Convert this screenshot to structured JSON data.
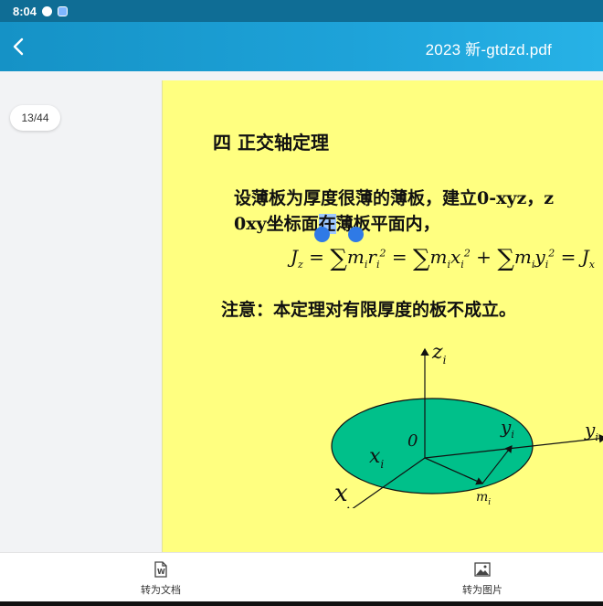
{
  "status_bar": {
    "time": "8:04",
    "icons": [
      "qq-icon",
      "app-notification-icon"
    ]
  },
  "app_bar": {
    "back_icon": "chevron-left-icon",
    "title": "2023 新-gtdzd.pdf"
  },
  "viewer": {
    "page_indicator": "13/44",
    "slide": {
      "heading": "四   正交轴定理",
      "paragraph_line1": "设薄板为厚度很薄的薄板，建立0-xyz，z",
      "paragraph_line2_before": "0xy坐标面",
      "paragraph_line2_selected": "在",
      "paragraph_line2_after": "薄板平面内，",
      "note": "注意：本定理对有限厚度的板不成立。",
      "diagram_labels": {
        "z_axis": "z",
        "z_sub": "i",
        "y_axis": "y",
        "y_sub": "i",
        "y_inner": "y",
        "y_inner_sub": "i",
        "x_inner": "x",
        "x_inner_sub": "i",
        "x_axis": "x",
        "origin": "0",
        "mass": "m",
        "mass_sub": "i"
      },
      "colors": {
        "slide_bg": "#ffff80",
        "ellipse_fill": "#00c08a",
        "selection": "#9dc7ff",
        "handle": "#2f7ae6"
      }
    }
  },
  "bottom_bar": {
    "to_doc_label": "转为文档",
    "to_doc_icon": "word-document-icon",
    "to_image_label": "转为图片",
    "to_image_icon": "image-icon"
  }
}
